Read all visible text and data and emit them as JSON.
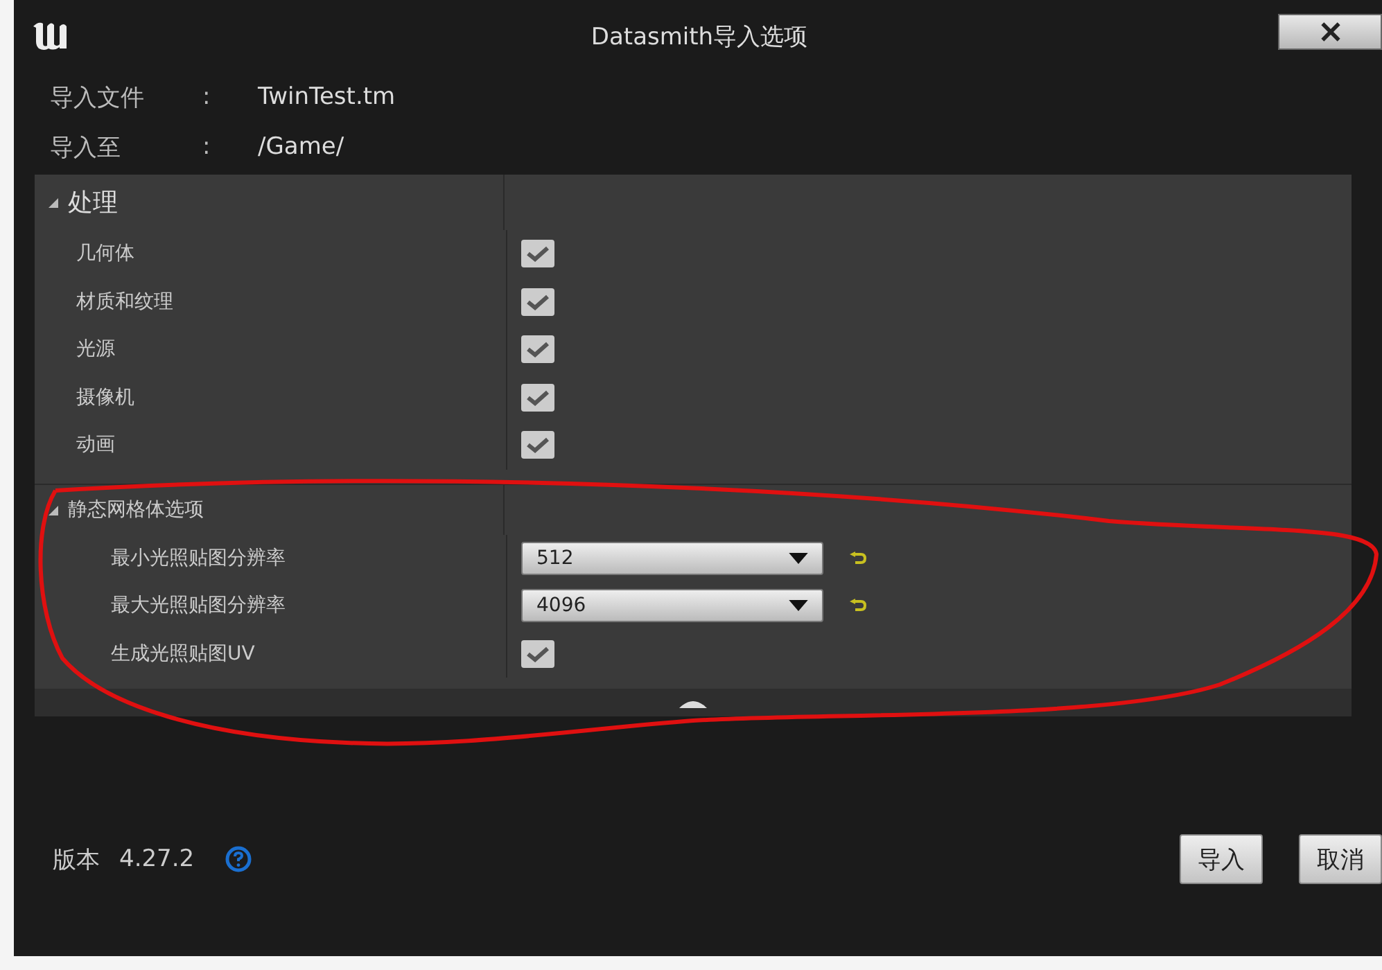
{
  "window": {
    "title": "Datasmith导入选项"
  },
  "info": [
    {
      "label": "导入文件",
      "separator": ":",
      "value": "TwinTest.tm"
    },
    {
      "label": "导入至",
      "separator": ":",
      "value": "/Game/"
    }
  ],
  "sections": [
    {
      "title": "处理",
      "expanded": true,
      "rows": [
        {
          "kind": "checkbox",
          "label": "几何体",
          "checked": true
        },
        {
          "kind": "checkbox",
          "label": "材质和纹理",
          "checked": true
        },
        {
          "kind": "checkbox",
          "label": "光源",
          "checked": true
        },
        {
          "kind": "checkbox",
          "label": "摄像机",
          "checked": true
        },
        {
          "kind": "checkbox",
          "label": "动画",
          "checked": true
        }
      ]
    },
    {
      "title": "静态网格体选项",
      "expanded": true,
      "rows": [
        {
          "kind": "dropdown",
          "label": "最小光照贴图分辨率",
          "value": "512",
          "resettable": true
        },
        {
          "kind": "dropdown",
          "label": "最大光照贴图分辨率",
          "value": "4096",
          "resettable": true
        },
        {
          "kind": "checkbox",
          "label": "生成光照贴图UV",
          "checked": true
        }
      ]
    }
  ],
  "footer": {
    "version_label": "版本",
    "version": "4.27.2",
    "buttons": [
      "导入",
      "取消"
    ]
  }
}
